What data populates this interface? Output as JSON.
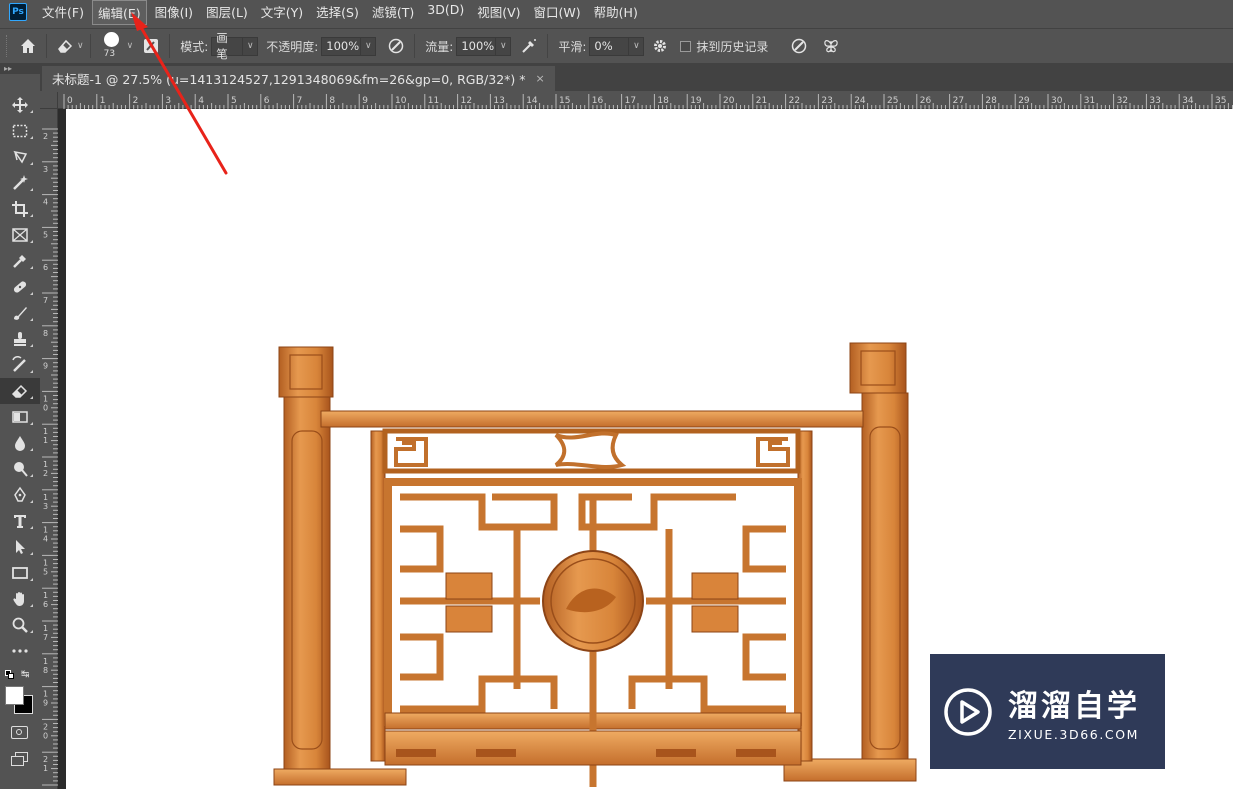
{
  "app": {
    "logo": "Ps"
  },
  "menu": [
    {
      "label": "文件(F)",
      "active": false
    },
    {
      "label": "编辑(E)",
      "active": true
    },
    {
      "label": "图像(I)",
      "active": false
    },
    {
      "label": "图层(L)",
      "active": false
    },
    {
      "label": "文字(Y)",
      "active": false
    },
    {
      "label": "选择(S)",
      "active": false
    },
    {
      "label": "滤镜(T)",
      "active": false
    },
    {
      "label": "3D(D)",
      "active": false
    },
    {
      "label": "视图(V)",
      "active": false
    },
    {
      "label": "窗口(W)",
      "active": false
    },
    {
      "label": "帮助(H)",
      "active": false
    }
  ],
  "options": {
    "brush_size": "73",
    "mode_label": "模式:",
    "mode_value": "画笔",
    "opacity_label": "不透明度:",
    "opacity_value": "100%",
    "flow_label": "流量:",
    "flow_value": "100%",
    "smoothing_label": "平滑:",
    "smoothing_value": "0%",
    "erase_history_label": "抹到历史记录"
  },
  "tools": [
    {
      "name": "move-tool-icon",
      "active": false
    },
    {
      "name": "rectangular-marquee-tool-icon",
      "active": false
    },
    {
      "name": "lasso-tool-icon",
      "active": false
    },
    {
      "name": "magic-wand-tool-icon",
      "active": false
    },
    {
      "name": "crop-tool-icon",
      "active": false
    },
    {
      "name": "frame-tool-icon",
      "active": false
    },
    {
      "name": "eyedropper-tool-icon",
      "active": false
    },
    {
      "name": "healing-brush-tool-icon",
      "active": false
    },
    {
      "name": "brush-tool-icon",
      "active": false
    },
    {
      "name": "clone-stamp-tool-icon",
      "active": false
    },
    {
      "name": "history-brush-tool-icon",
      "active": false
    },
    {
      "name": "eraser-tool-icon",
      "active": true
    },
    {
      "name": "gradient-tool-icon",
      "active": false
    },
    {
      "name": "blur-tool-icon",
      "active": false
    },
    {
      "name": "dodge-tool-icon",
      "active": false
    },
    {
      "name": "pen-tool-icon",
      "active": false
    },
    {
      "name": "type-tool-icon",
      "active": false
    },
    {
      "name": "path-selection-tool-icon",
      "active": false
    },
    {
      "name": "rectangle-tool-icon",
      "active": false
    },
    {
      "name": "hand-tool-icon",
      "active": false
    },
    {
      "name": "zoom-tool-icon",
      "active": false
    },
    {
      "name": "more-tools-icon",
      "active": false
    }
  ],
  "document_tab": {
    "title": "未标题-1 @ 27.5% (u=1413124527,1291348069&fm=26&gp=0, RGB/32*) *",
    "close": "×"
  },
  "ruler": {
    "top_labels": [
      "0",
      "1",
      "2",
      "3",
      "4",
      "5",
      "6",
      "7",
      "8",
      "9",
      "10",
      "11",
      "12",
      "13",
      "14",
      "15",
      "16",
      "17",
      "18",
      "19",
      "20",
      "21",
      "22",
      "23",
      "24",
      "25",
      "26",
      "27",
      "28",
      "29",
      "30",
      "31",
      "32",
      "33",
      "34",
      "35"
    ],
    "left_labels": [
      "2",
      "3",
      "4",
      "5",
      "6",
      "7",
      "8",
      "9",
      "10",
      "11",
      "12",
      "13",
      "14",
      "15",
      "16",
      "17",
      "18",
      "19",
      "20",
      "21"
    ]
  },
  "colors": {
    "annotation_arrow": "#e8231a",
    "wood_main": "#d9843a",
    "wood_light": "#efab62",
    "wood_dark": "#a8541c",
    "watermark_bg": "#2f3a58"
  },
  "watermark": {
    "title": "溜溜自学",
    "url": "ZIXUE.3D66.COM"
  }
}
